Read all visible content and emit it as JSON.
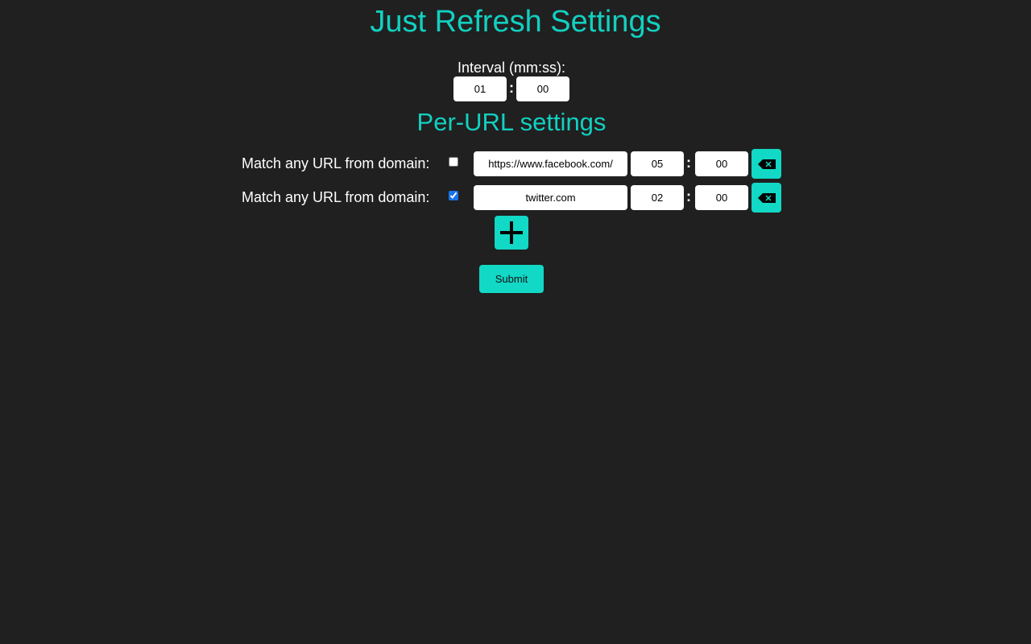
{
  "header": {
    "title": "Just Refresh Settings"
  },
  "global_interval": {
    "label": "Interval (mm:ss):",
    "minutes": "01",
    "seconds": "00",
    "separator": ":"
  },
  "per_url": {
    "heading": "Per-URL settings",
    "rows": [
      {
        "label": "Match any URL from domain:",
        "match_domain": false,
        "url": "https://www.facebook.com/",
        "minutes": "05",
        "seconds": "00",
        "delete_icon": "backspace-icon"
      },
      {
        "label": "Match any URL from domain:",
        "match_domain": true,
        "url": "twitter.com",
        "minutes": "02",
        "seconds": "00",
        "delete_icon": "backspace-icon"
      }
    ],
    "add_icon": "plus-icon"
  },
  "actions": {
    "submit_label": "Submit"
  },
  "colors": {
    "accent": "#12d8c6",
    "background": "#202020"
  }
}
